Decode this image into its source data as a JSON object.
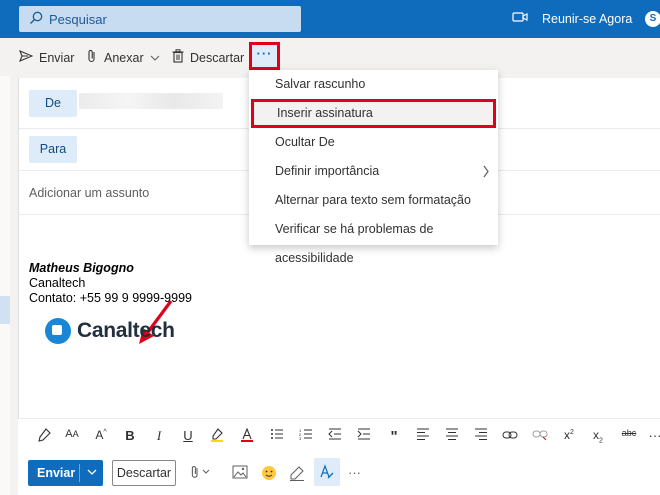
{
  "topbar": {
    "search_placeholder": "Pesquisar",
    "meet_label": "Reunir-se Agora",
    "skype_letter": "S"
  },
  "commandbar": {
    "send_label": "Enviar",
    "attach_label": "Anexar",
    "discard_label": "Descartar",
    "more_label": "···"
  },
  "menu": {
    "items": [
      {
        "label": "Salvar rascunho"
      },
      {
        "label": "Inserir assinatura"
      },
      {
        "label": "Ocultar De"
      },
      {
        "label": "Definir importância"
      },
      {
        "label": "Alternar para texto sem formatação"
      },
      {
        "label": "Verificar se há problemas de acessibilidade"
      }
    ]
  },
  "compose": {
    "from_label": "De",
    "to_label": "Para",
    "subject_placeholder": "Adicionar um assunto",
    "signature": {
      "name": "Matheus Bigogno",
      "company": "Canaltech",
      "contact": "Contato: +55 99 9 9999-9999"
    },
    "logo_text": "Canaltech"
  },
  "format_toolbar": {
    "icons": [
      "paintbrush-icon",
      "font-size-icon",
      "font-grow-icon",
      "bold-icon",
      "italic-icon",
      "underline-icon",
      "highlight-icon",
      "font-color-icon",
      "bullets-icon",
      "numbering-icon",
      "outdent-icon",
      "indent-icon",
      "quote-icon",
      "align-left-icon",
      "align-center-icon",
      "align-right-icon",
      "link-icon",
      "unlink-icon",
      "superscript-icon",
      "subscript-icon",
      "strikethrough-icon",
      "more-icon"
    ]
  },
  "actions": {
    "send_label": "Enviar",
    "discard_label": "Descartar",
    "more_label": "···"
  },
  "colors": {
    "brand_blue": "#0f6cbd",
    "highlight_red": "#e0001b"
  }
}
